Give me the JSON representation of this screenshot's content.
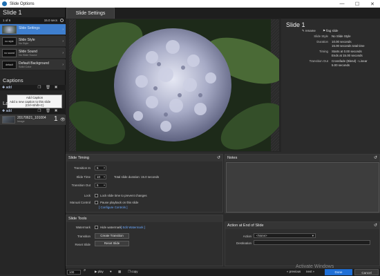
{
  "window": {
    "title": "Slide Options",
    "minimize": "—",
    "maximize": "☐",
    "close": "✕"
  },
  "left": {
    "heading": "Slide 1",
    "slide_index": "1 of 6",
    "slide_duration": "15.0 secs",
    "layers": [
      {
        "thumb": "",
        "title": "Slide Settings",
        "sub": "",
        "arrow": "›",
        "selected": true
      },
      {
        "thumb": "no style",
        "title": "Slide Style",
        "sub": "No Style",
        "arrow": "›"
      },
      {
        "thumb": "no sound",
        "title": "Slide Sound",
        "sub": "No Slide Sound",
        "arrow": "›"
      },
      {
        "thumb": "default",
        "title": "Default Background",
        "sub": "Solid Color",
        "arrow": "›"
      }
    ],
    "captions_heading": "Captions",
    "add_label": "add",
    "layers_heading": "La",
    "tooltip_title": "Add Caption",
    "tooltip_text": "Add a new caption to this slide",
    "tooltip_shortcut": "(Ctrl+Shift+C)",
    "layer_item": {
      "title": "20170621_101004",
      "sub": "Image",
      "num": "1"
    }
  },
  "main": {
    "tab": "Slide Settings",
    "info": {
      "title": "Slide 1",
      "rename_label": "rename",
      "flag_label": "flag slide",
      "rows": [
        {
          "label": "Slide Style",
          "value": "No Slide Style"
        },
        {
          "label": "Duration",
          "value": "10.00 seconds"
        },
        {
          "label": "",
          "value": "15.00 seconds total time"
        },
        {
          "label": "Timing",
          "value": "Starts at 0.00 seconds"
        },
        {
          "label": "",
          "value": "Ends at 15.00 seconds"
        },
        {
          "label": "Transition Out",
          "value": "Crossfade (Blend) - Linear"
        },
        {
          "label": "",
          "value": "5.00 seconds"
        }
      ]
    },
    "timing": {
      "title": "Slide Timing",
      "transition_in_label": "Transition In",
      "transition_in": "5",
      "slide_time_label": "Slide Time",
      "slide_time": "10",
      "total_duration": "Total slide duration: 15.0 seconds",
      "transition_out_label": "Transition Out",
      "transition_out": "5",
      "lock_label": "Lock",
      "lock_text": "Lock slide time to prevent changes",
      "manual_label": "Manual Control",
      "manual_text": "Pause playback on this slide",
      "configure_link": "[ Configure Controls ]"
    },
    "notes": {
      "title": "Notes"
    },
    "tools": {
      "title": "Slide Tools",
      "watermark_label": "Watermark",
      "watermark_text": "Hide watermark",
      "watermark_link": "[ Edit Watermark ]",
      "transition_label": "Transition",
      "transition_button": "Create Transition",
      "reset_label": "Reset Slide",
      "reset_button": "Reset Slide"
    },
    "action": {
      "title": "Action at End of Slide",
      "action_label": "Action",
      "action_value": "<None>",
      "destination_label": "Destination"
    }
  },
  "bottom": {
    "zoom": "100",
    "play_label": "play",
    "copy_label": "copy",
    "previous_label": "« previous",
    "next_label": "next »",
    "done_label": "Done",
    "cancel_label": "Cancel"
  },
  "watermark_os": "Activate Windows"
}
